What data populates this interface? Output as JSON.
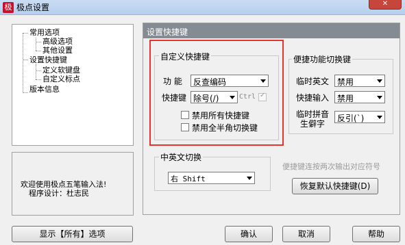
{
  "window": {
    "title": "极点设置",
    "app_icon_char": "极",
    "close_glyph": "✕"
  },
  "tree": {
    "items": [
      {
        "label": "常用选项"
      },
      {
        "label": "高级选项"
      },
      {
        "label": "其他设置"
      },
      {
        "label": "设置快捷键"
      },
      {
        "label": "定义软键盘"
      },
      {
        "label": "自定义标点"
      },
      {
        "label": "版本信息"
      }
    ]
  },
  "welcome": {
    "line1": "欢迎使用极点五笔输入法!",
    "line2": "程序设计：杜志民"
  },
  "panel": {
    "title": "设置快捷键"
  },
  "custom_group": {
    "title": "自定义快捷键",
    "function_label": "功 能",
    "function_value": "反查编码",
    "hotkey_label": "快捷键",
    "hotkey_value": "除号(/)",
    "ctrl_label": "Ctrl",
    "ctrl_check_mark": "✓",
    "disable_all_label": "禁用所有快捷键",
    "disable_fullhalf_label": "禁用全半角切换键"
  },
  "convenience_group": {
    "title": "便捷功能切换键",
    "temp_english_label": "临时英文",
    "temp_english_value": "禁用",
    "quick_input_label": "快捷输入",
    "quick_input_value": "禁用",
    "temp_pinyin_label_1": "临时拼音",
    "temp_pinyin_label_2": "生僻字",
    "temp_pinyin_value": "反引(`)"
  },
  "cn_en_group": {
    "title": "中英文切换",
    "value": "右 Shift"
  },
  "hint": "便捷键连按两次输出对应符号",
  "buttons": {
    "restore": "恢复默认快捷键(D)",
    "show_all": "显示【所有】选项",
    "ok": "确认",
    "cancel": "取消",
    "help": "帮助"
  },
  "colors": {
    "highlight_box": "#e5342e",
    "panel_header": "#848b93"
  }
}
